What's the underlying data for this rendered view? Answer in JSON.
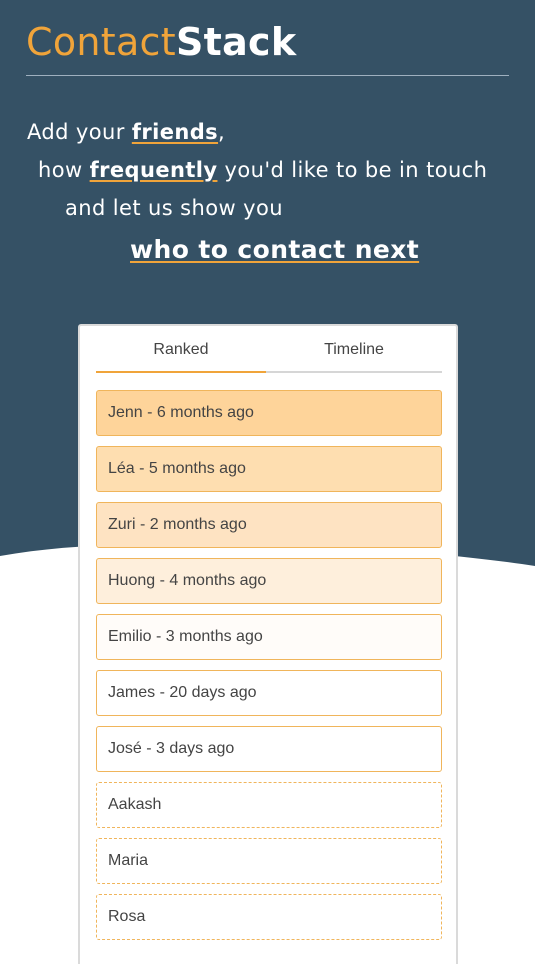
{
  "brand": {
    "part1": "Contact",
    "part2": "Stack"
  },
  "tagline": {
    "l1_pre": "Add your ",
    "l1_em": "friends",
    "l1_post": ",",
    "l2_pre": "how ",
    "l2_em": "frequently",
    "l2_post": " you'd like to be in touch",
    "l3": "and let us show you",
    "l4_em": "who to contact next"
  },
  "colors": {
    "hero_bg": "#355165",
    "accent": "#f0a43a",
    "border": "#f0b55b"
  },
  "tabs": [
    {
      "label": "Ranked",
      "active": true
    },
    {
      "label": "Timeline",
      "active": false
    }
  ],
  "contacts": [
    {
      "label": "Jenn - 6 months ago",
      "bg": "#fed49a",
      "dashed": false
    },
    {
      "label": "Léa - 5 months ago",
      "bg": "#fedeb0",
      "dashed": false
    },
    {
      "label": "Zuri - 2 months ago",
      "bg": "#fee3c2",
      "dashed": false
    },
    {
      "label": "Huong - 4 months ago",
      "bg": "#feefdc",
      "dashed": false
    },
    {
      "label": "Emilio - 3 months ago",
      "bg": "#fffcf9",
      "dashed": false
    },
    {
      "label": "James - 20 days ago",
      "bg": "#ffffff",
      "dashed": false
    },
    {
      "label": "José - 3 days ago",
      "bg": "#ffffff",
      "dashed": false
    },
    {
      "label": "Aakash",
      "bg": "#ffffff",
      "dashed": true
    },
    {
      "label": "Maria",
      "bg": "#ffffff",
      "dashed": true
    },
    {
      "label": "Rosa",
      "bg": "#ffffff",
      "dashed": true
    }
  ]
}
